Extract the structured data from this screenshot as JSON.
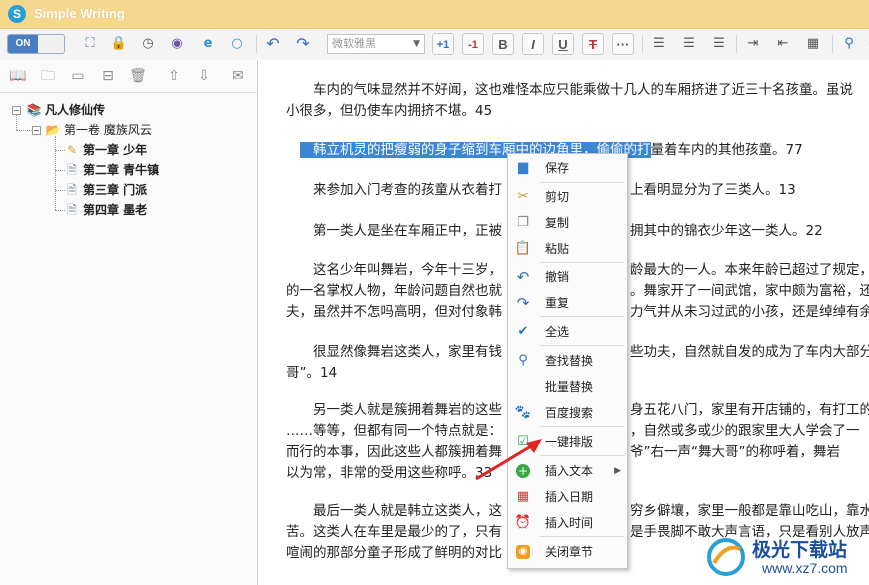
{
  "app": {
    "title": "Simple Writing",
    "logo_letter": "S"
  },
  "toolbar": {
    "toggle_label": "ON",
    "font_select_value": "微软雅黑",
    "font_size_up": "+1",
    "font_size_down": "-1",
    "bold": "B",
    "italic": "I",
    "underline": "U",
    "strike": "T",
    "more": "···"
  },
  "tree": {
    "book": "凡人修仙传",
    "volume": "第一卷  魔族风云",
    "chapters": [
      {
        "label": "第一章  少年",
        "active": true
      },
      {
        "label": "第二章  青牛镇",
        "active": false
      },
      {
        "label": "第三章  门派",
        "active": false
      },
      {
        "label": "第四章  墨老",
        "active": false
      }
    ]
  },
  "editor": {
    "paragraphs": [
      "车内的气味显然并不好闻，这也难怪本应只能乘做十几人的车厢挤进了近三十名孩童。虽说",
      "小很多，但仍使车内拥挤不堪。45",
      "韩立机灵的把瘦弱的身子缩到车厢中的边角里，偷偷的打",
      "量着车内的其他孩童。77",
      "来参加入门考查的孩童从衣着打",
      "上看明显分为了三类人。13",
      "第一类人是坐在车厢正中，正被",
      "拥其中的锦衣少年这一类人。22",
      "这名少年叫舞岩，今年十三岁，",
      "龄最大的一人。本来年龄已超过了规定，但其有一",
      "的一名掌权人物，年龄问题自然也就",
      "。舞家开了一间武馆，家中颇为富裕，还自小",
      "夫，虽然并不怎吗高明，但对付象韩",
      "力气并从未习过武的小孩，还是绰绰有余",
      "很显然像舞岩这类人，家里有钱",
      "些功夫，自然就自发的成为了车内大部分孩",
      "哥”。14",
      "另一类人就是簇拥着舞岩的这些",
      "身五花八门，家里有开店铺的，有打工的",
      "……等等，但都有同一个特点就是：",
      "，自然或多或少的跟家里大人学会了一",
      "而行的本事，因此这些人都簇拥着舞",
      "爷”右一声“舞大哥”的称呼着，舞岩",
      "以为常，非常的受用这些称呼。33",
      "最后一类人就是韩立这类人，这",
      "穷乡僻壤，家里一般都是靠山吃山，靠水",
      "苦。这类人在车里是最少的了，只有",
      "是手畏脚不敢大声言语，只是看别人放声",
      "喧闹的那部分童子形成了鲜明的对比"
    ]
  },
  "context_menu": {
    "items": [
      {
        "label": "保存",
        "icon": "save-icon"
      },
      {
        "label": "剪切",
        "icon": "scissors-icon"
      },
      {
        "label": "复制",
        "icon": "copy-icon"
      },
      {
        "label": "粘贴",
        "icon": "paste-icon"
      },
      {
        "label": "撤销",
        "icon": "undo-icon"
      },
      {
        "label": "重复",
        "icon": "redo-icon"
      },
      {
        "label": "全选",
        "icon": "select-all-icon"
      },
      {
        "label": "查找替换",
        "icon": "search-icon"
      },
      {
        "label": "批量替换",
        "icon": ""
      },
      {
        "label": "百度搜索",
        "icon": "baidu-icon"
      },
      {
        "label": "一键排版",
        "icon": "format-icon"
      },
      {
        "label": "插入文本",
        "icon": "plus-icon",
        "submenu": "▶"
      },
      {
        "label": "插入日期",
        "icon": "calendar-icon"
      },
      {
        "label": "插入时间",
        "icon": "clock-icon"
      },
      {
        "label": "关闭章节",
        "icon": "close-chapter-icon"
      }
    ]
  },
  "watermark": {
    "brand": "极光下载站",
    "url": "www.xz7.com"
  }
}
